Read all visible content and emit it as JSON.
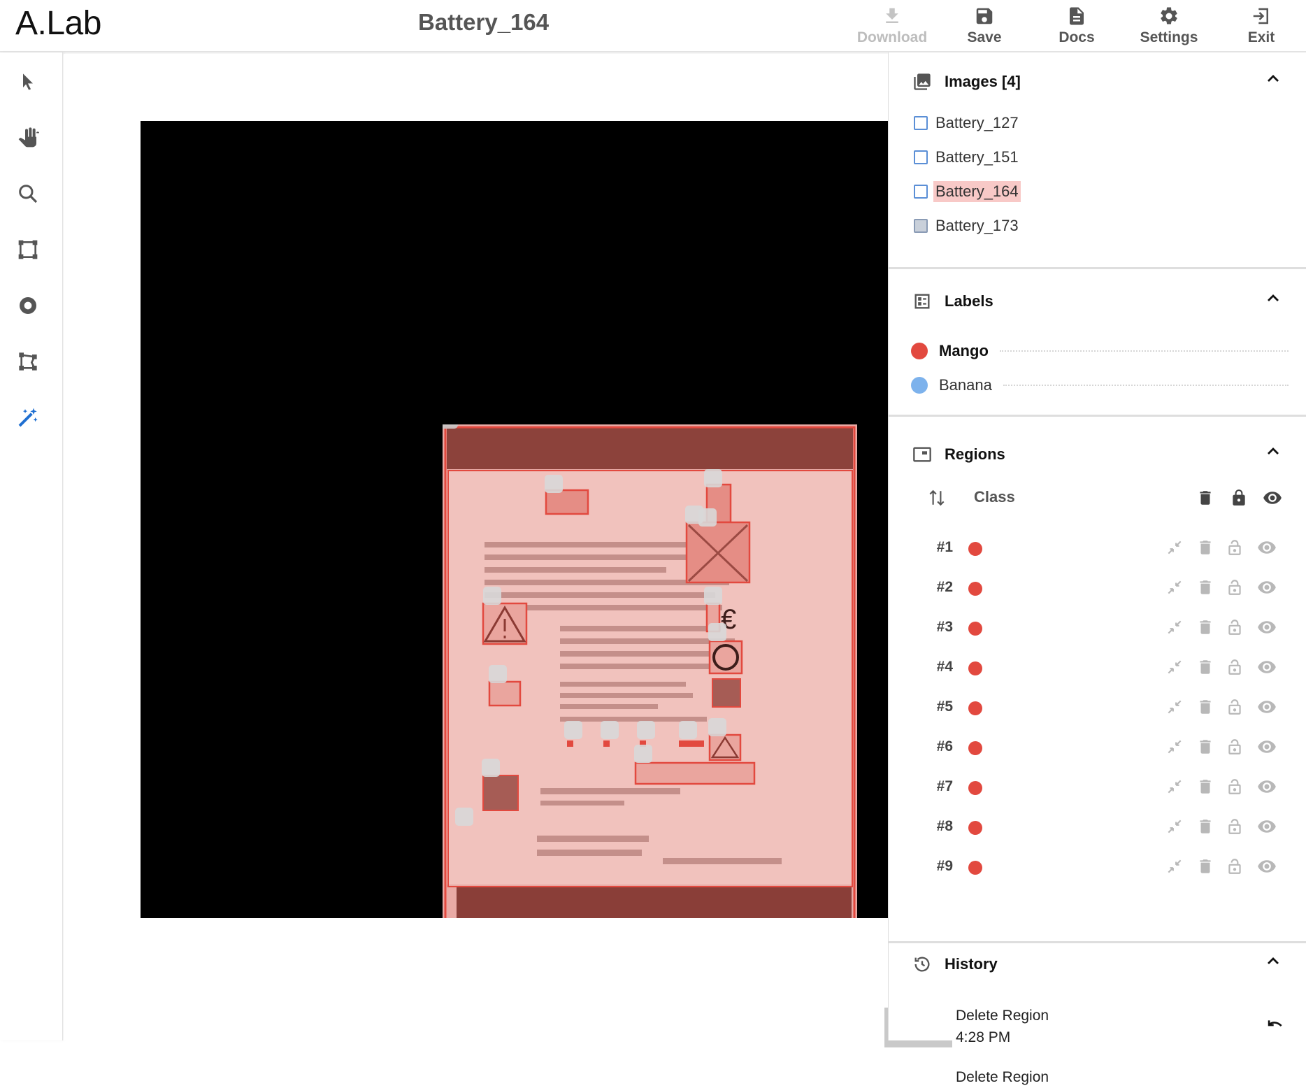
{
  "app": {
    "title": "A.Lab",
    "document_title": "Battery_164"
  },
  "header_actions": [
    {
      "name": "download",
      "label": "Download",
      "icon": "download-icon",
      "enabled": false
    },
    {
      "name": "save",
      "label": "Save",
      "icon": "save-icon",
      "enabled": true
    },
    {
      "name": "docs",
      "label": "Docs",
      "icon": "document-icon",
      "enabled": true
    },
    {
      "name": "settings",
      "label": "Settings",
      "icon": "gear-icon",
      "enabled": true
    },
    {
      "name": "exit",
      "label": "Exit",
      "icon": "exit-icon",
      "enabled": true
    }
  ],
  "tools": [
    {
      "name": "select",
      "icon": "cursor-arrow-icon"
    },
    {
      "name": "pan",
      "icon": "hand-icon"
    },
    {
      "name": "zoom",
      "icon": "magnifier-icon"
    },
    {
      "name": "bounding-box",
      "icon": "box-icon"
    },
    {
      "name": "circle",
      "icon": "circle-icon"
    },
    {
      "name": "polygon",
      "icon": "polygon-icon"
    },
    {
      "name": "auto-annotate",
      "icon": "magic-wand-icon",
      "accent": "#1f6fd1"
    }
  ],
  "canvas": {
    "zoom": "100%"
  },
  "images_panel": {
    "title": "Images [4]",
    "items": [
      {
        "name": "Battery_127",
        "checked": false,
        "active": false
      },
      {
        "name": "Battery_151",
        "checked": false,
        "active": false
      },
      {
        "name": "Battery_164",
        "checked": false,
        "active": true
      },
      {
        "name": "Battery_173",
        "checked": true,
        "active": false
      }
    ]
  },
  "labels_panel": {
    "title": "Labels",
    "items": [
      {
        "name": "Mango",
        "color": "#e2493f",
        "selected": true
      },
      {
        "name": "Banana",
        "color": "#7db2ec",
        "selected": false
      }
    ]
  },
  "regions_panel": {
    "title": "Regions",
    "class_header": "Class",
    "rows": [
      {
        "id": "#1",
        "color": "#e2493f"
      },
      {
        "id": "#2",
        "color": "#e2493f"
      },
      {
        "id": "#3",
        "color": "#e2493f"
      },
      {
        "id": "#4",
        "color": "#e2493f"
      },
      {
        "id": "#5",
        "color": "#e2493f"
      },
      {
        "id": "#6",
        "color": "#e2493f"
      },
      {
        "id": "#7",
        "color": "#e2493f"
      },
      {
        "id": "#8",
        "color": "#e2493f"
      },
      {
        "id": "#9",
        "color": "#e2493f"
      }
    ]
  },
  "history_panel": {
    "title": "History",
    "items": [
      {
        "action": "Delete Region",
        "time": "4:28 PM"
      },
      {
        "action": "Delete Region",
        "time": ""
      }
    ]
  },
  "colors": {
    "region": "#e2493f",
    "accent": "#1f6fd1"
  }
}
